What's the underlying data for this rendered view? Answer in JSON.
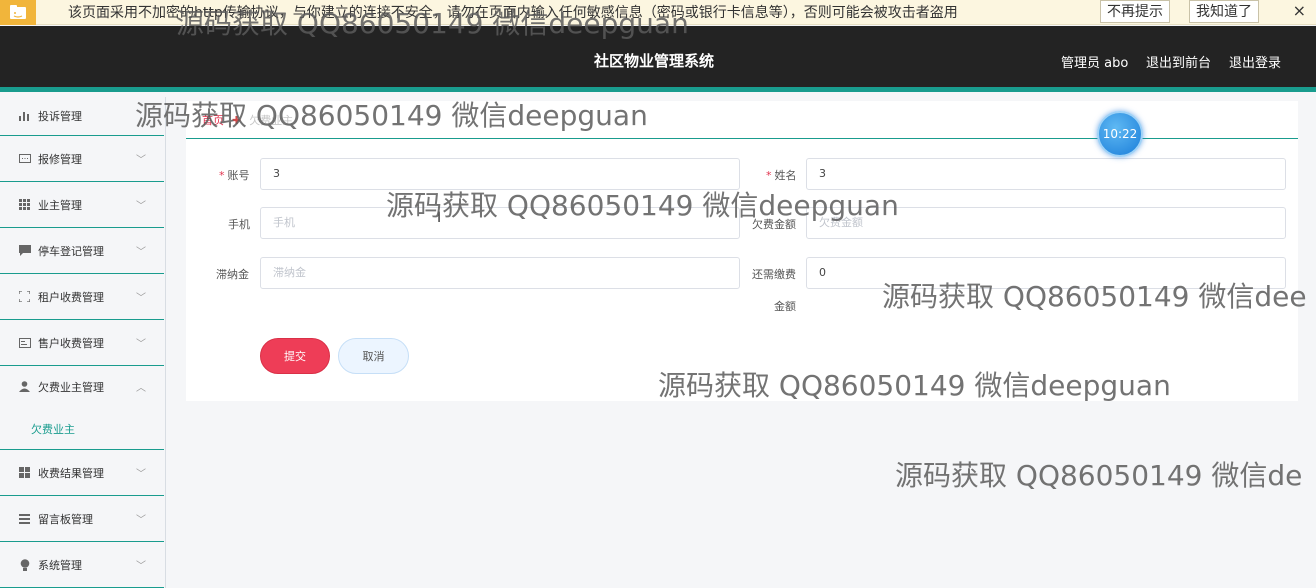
{
  "warning_bar": {
    "text": "该页面采用不加密的http传输协议，与你建立的连接不安全，请勿在页面内输入任何敏感信息（密码或银行卡信息等），否则可能会被攻击者盗用",
    "dismiss_label": "不再提示",
    "ok_label": "我知道了",
    "close_glyph": "×",
    "icon": "folder-icon"
  },
  "header": {
    "title": "社区物业管理系统",
    "user_label": "管理员 abo",
    "front_label": "退出到前台",
    "logout_label": "退出登录"
  },
  "sidebar": {
    "items": [
      {
        "label": "投诉管理",
        "icon": "bar-chart-icon"
      },
      {
        "label": "报修管理",
        "icon": "message-icon"
      },
      {
        "label": "业主管理",
        "icon": "grid-icon"
      },
      {
        "label": "停车登记管理",
        "icon": "chat-icon"
      },
      {
        "label": "租户收费管理",
        "icon": "fullscreen-icon"
      },
      {
        "label": "售户收费管理",
        "icon": "card-icon"
      },
      {
        "label": "欠费业主管理",
        "icon": "user-icon"
      },
      {
        "label": "收费结果管理",
        "icon": "grid-icon"
      },
      {
        "label": "留言板管理",
        "icon": "list-icon"
      },
      {
        "label": "系统管理",
        "icon": "bulb-icon"
      }
    ],
    "sub_item": "欠费业主"
  },
  "breadcrumb": {
    "home": "首页",
    "current": "欠费业主"
  },
  "form": {
    "account_label": "账号",
    "account_value": "3",
    "name_label": "姓名",
    "name_value": "3",
    "phone_label": "手机",
    "phone_placeholder": "手机",
    "arrears_label": "欠费金额",
    "arrears_placeholder": "欠费金额",
    "latefee_label": "滞纳金",
    "latefee_placeholder": "滞纳金",
    "payable_label_1": "还需缴费",
    "payable_label_2": "金额",
    "payable_value": "0",
    "submit_label": "提交",
    "cancel_label": "取消"
  },
  "clock": "10:22",
  "watermarks": [
    "源码获取 QQ86050149 微信deepguan",
    "源码获取 QQ86050149 微信deepguan",
    "源码获取 QQ86050149 微信deepguan",
    "源码获取 QQ86050149 微信dee",
    "源码获取 QQ86050149 微信deepguan",
    "源码获取 QQ86050149 微信de"
  ]
}
